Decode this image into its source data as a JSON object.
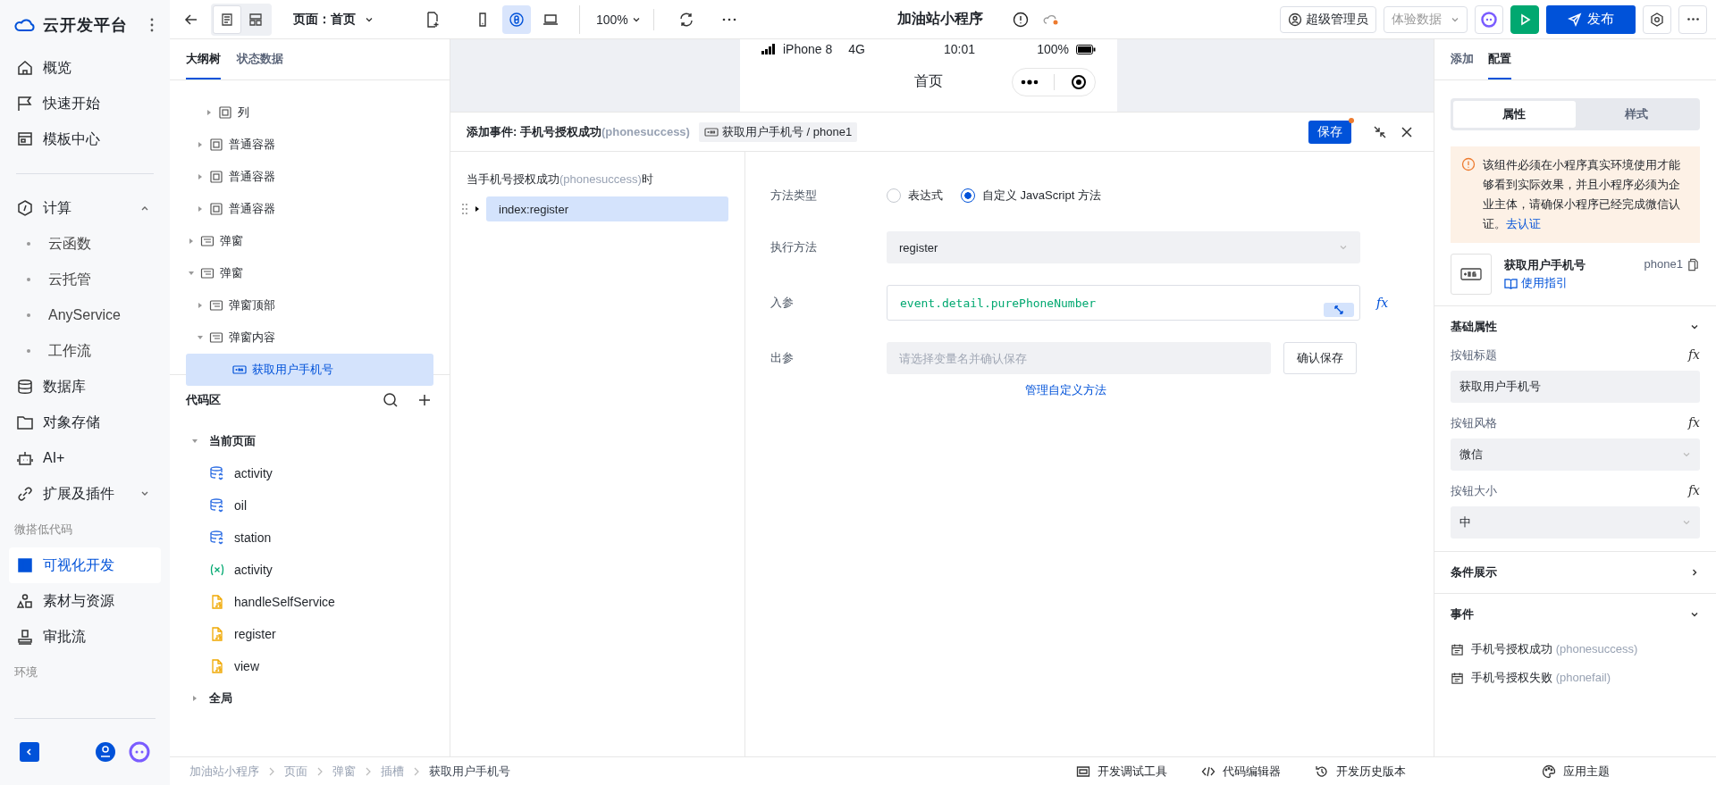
{
  "app": {
    "name": "云开发平台"
  },
  "nav": [
    [
      {
        "kind": "item",
        "label": "概览",
        "selected": false
      },
      {
        "kind": "item",
        "label": "快速开始",
        "selected": false
      },
      {
        "kind": "item",
        "label": "模板中心",
        "selected": false
      }
    ],
    [
      {
        "kind": "item",
        "label": "计算",
        "selected": false,
        "expanded": true
      },
      {
        "kind": "sub",
        "label": "云函数"
      },
      {
        "kind": "sub",
        "label": "云托管"
      },
      {
        "kind": "sub",
        "label": "AnyService"
      },
      {
        "kind": "sub",
        "label": "工作流"
      },
      {
        "kind": "item",
        "label": "数据库",
        "selected": false
      },
      {
        "kind": "item",
        "label": "对象存储",
        "selected": false
      },
      {
        "kind": "item",
        "label": "AI+",
        "selected": false
      },
      {
        "kind": "item",
        "label": "扩展及插件",
        "selected": false,
        "expanded": false
      },
      {
        "kind": "section",
        "label": "微搭低代码"
      },
      {
        "kind": "item",
        "label": "可视化开发",
        "selected": true
      },
      {
        "kind": "item",
        "label": "素材与资源",
        "selected": false
      },
      {
        "kind": "item",
        "label": "审批流",
        "selected": false
      },
      {
        "kind": "section",
        "label": "环境"
      }
    ]
  ],
  "toolbar": {
    "view_modes": [
      {
        "selected": true
      },
      {
        "selected": false
      }
    ],
    "page_select": "页面：首页",
    "devices": [
      {
        "selected": false
      },
      {
        "selected": true
      },
      {
        "selected": false
      }
    ],
    "zoom": "100%",
    "title": "加油站小程序",
    "user": "超级管理员",
    "data_select": "体验数据",
    "publish": "发布"
  },
  "outline": {
    "tabs": [
      {
        "label": "大纲树",
        "selected": true
      },
      {
        "label": "状态数据",
        "selected": false
      }
    ],
    "tree": [
      {
        "children": [
          {
            "children": [
              {
                "children": [
                  {
                    "label": "列",
                    "kind": "container",
                    "expanded": false,
                    "selected": false
                  }
                ]
              },
              {
                "label": "普通容器",
                "kind": "container",
                "expanded": false,
                "selected": false
              },
              {
                "label": "普通容器",
                "kind": "container",
                "expanded": false,
                "selected": false
              },
              {
                "label": "普通容器",
                "kind": "container",
                "expanded": false,
                "selected": false
              }
            ]
          },
          {
            "label": "弹窗",
            "kind": "popup",
            "expanded": false,
            "selected": false
          },
          {
            "label": "弹窗",
            "kind": "popup",
            "expanded": true,
            "selected": false,
            "children": [
              {
                "label": "弹窗顶部",
                "kind": "popup",
                "expanded": false,
                "selected": false
              },
              {
                "label": "弹窗内容",
                "kind": "popup",
                "expanded": true,
                "selected": false,
                "children": [
                  {
                    "label": "获取用户手机号",
                    "kind": "phone-button",
                    "selected": true
                  }
                ]
              }
            ]
          }
        ]
      }
    ]
  },
  "code_area": {
    "title": "代码区",
    "groups": [
      {
        "label": "当前页面",
        "expanded": true,
        "items": [
          {
            "kind": "datasource",
            "label": "activity"
          },
          {
            "kind": "datasource",
            "label": "oil"
          },
          {
            "kind": "datasource",
            "label": "station"
          },
          {
            "kind": "variable",
            "label": "activity"
          },
          {
            "kind": "js",
            "label": "handleSelfService"
          },
          {
            "kind": "js",
            "label": "register"
          },
          {
            "kind": "js",
            "label": "view"
          }
        ]
      },
      {
        "label": "全局",
        "expanded": false
      }
    ]
  },
  "preview": {
    "device": "iPhone 8",
    "network": "4G",
    "time": "10:01",
    "battery": "100%",
    "page_title": "首页"
  },
  "event_panel": {
    "title": "添加事件: 手机号授权成功",
    "event_code": "(phonesuccess)",
    "component": "获取用户手机号 / phone1",
    "save": "保存",
    "unsaved": true,
    "trigger": {
      "before": "当手机号授权成功",
      "code": "(phonesuccess)",
      "after": "时"
    },
    "actions": [
      {
        "label": "index:register",
        "selected": true,
        "expanded": false
      }
    ],
    "method_type": {
      "label": "方法类型",
      "options": [
        {
          "label": "表达式",
          "selected": false
        },
        {
          "label": "自定义 JavaScript 方法",
          "selected": true
        }
      ]
    },
    "method": {
      "label": "执行方法",
      "value": "register"
    },
    "input_param": {
      "label": "入参",
      "value": "event.detail.purePhoneNumber",
      "fx": "fx"
    },
    "output_param": {
      "label": "出参",
      "placeholder": "请选择变量名并确认保存",
      "button": "确认保存"
    },
    "manage_link": "管理自定义方法"
  },
  "config": {
    "tabs": [
      {
        "label": "添加",
        "selected": false
      },
      {
        "label": "配置",
        "selected": true
      }
    ],
    "segments": [
      {
        "label": "属性",
        "selected": true
      },
      {
        "label": "样式",
        "selected": false
      }
    ],
    "notice": {
      "text": "该组件必须在小程序真实环境使用才能够看到实际效果，并且小程序必须为企业主体，请确保小程序已经完成微信认证。",
      "link": "去认证"
    },
    "component": {
      "name": "获取用户手机号",
      "guide": "使用指引",
      "id": "phone1"
    },
    "sections": [
      {
        "title": "基础属性",
        "expanded": true,
        "fields": [
          {
            "label": "按钮标题",
            "kind": "input",
            "value": "获取用户手机号",
            "fx": "fx"
          },
          {
            "label": "按钮风格",
            "kind": "select",
            "value": "微信",
            "fx": "fx"
          },
          {
            "label": "按钮大小",
            "kind": "select",
            "value": "中",
            "fx": "fx"
          }
        ]
      },
      {
        "title": "条件展示",
        "expanded": false
      },
      {
        "title": "事件",
        "expanded": true,
        "events": [
          {
            "label": "手机号授权成功",
            "code": "(phonesuccess)"
          },
          {
            "label": "手机号授权失败",
            "code": "(phonefail)"
          }
        ]
      }
    ]
  },
  "breadcrumb": [
    "加油站小程序",
    "页面",
    "弹窗",
    "插槽",
    "获取用户手机号"
  ],
  "bottom_tools": [
    "开发调试工具",
    "代码编辑器",
    "开发历史版本"
  ],
  "theme_button": "应用主题"
}
